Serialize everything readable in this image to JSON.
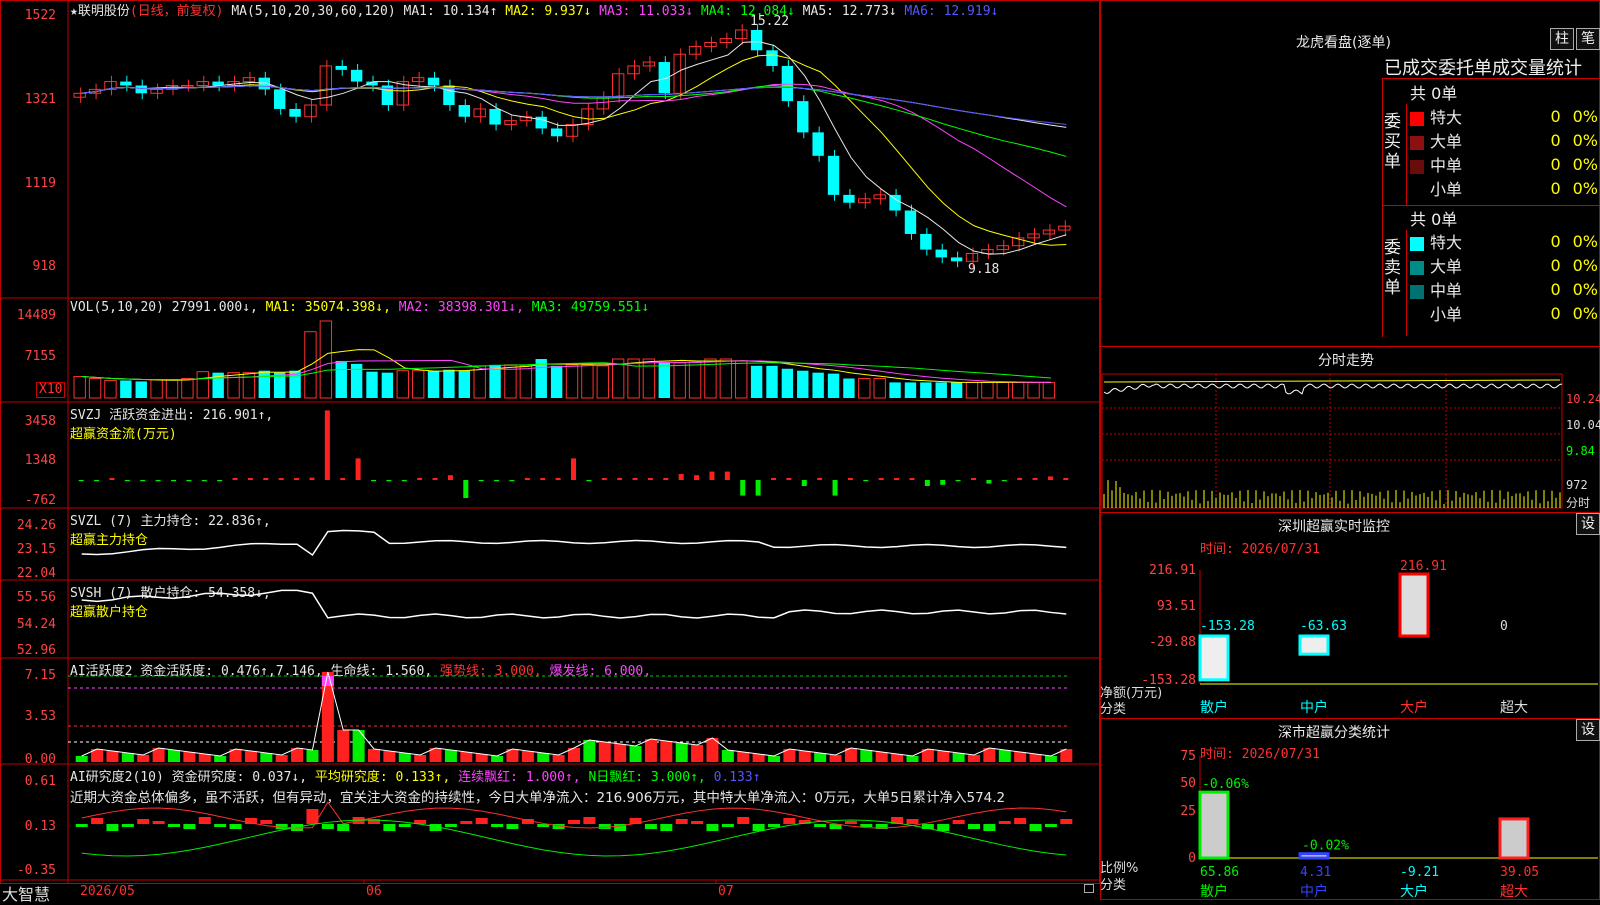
{
  "stock": {
    "name": "★联明股份",
    "mode": "(日线，前复权)"
  },
  "ma_header": {
    "label": "MA(5,10,20,30,60,120)",
    "items": [
      {
        "text": "MA1: 10.134↑",
        "color": "#e6e6e6"
      },
      {
        "text": "MA2: 9.937↓",
        "color": "#ffff00"
      },
      {
        "text": "MA3: 11.033↓",
        "color": "#ff44ff"
      },
      {
        "text": "MA4: 12.084↓",
        "color": "#00ff00"
      },
      {
        "text": "MA5: 12.773↓",
        "color": "#e6e6e6"
      },
      {
        "text": "MA6: 12.919↓",
        "color": "#5555ff"
      }
    ],
    "high_mark": "15.22",
    "low_mark": "9.18"
  },
  "price_axis": [
    "1522",
    "1321",
    "1119",
    "918"
  ],
  "vol_header": {
    "label": "VOL(5,10,20)",
    "value": "27991.000↓,",
    "ma1": "MA1: 35074.398↓,",
    "ma2": "MA2: 38398.301↓,",
    "ma3": "MA3: 49759.551↓"
  },
  "vol_axis": [
    "14489",
    "7155"
  ],
  "vol_unit": "X10",
  "svzj": {
    "label": "SVZJ  活跃资金进出: 216.901↑,",
    "sub": "超赢资金流(万元)",
    "axis": [
      "3458",
      "1348",
      "-762"
    ]
  },
  "svzl": {
    "label": "SVZL (7) 主力持仓: 22.836↑,",
    "sub": "超赢主力持仓",
    "axis": [
      "24.26",
      "23.15",
      "22.04"
    ]
  },
  "svsh": {
    "label": "SVSH (7) 散户持仓: 54.358↓,",
    "sub": "超赢散户持仓",
    "axis": [
      "55.56",
      "54.24",
      "52.96"
    ]
  },
  "ai1": {
    "label": "AI活跃度2 资金活跃度: 0.476↑,7.146,",
    "life": "生命线: 1.560,",
    "strong": "强势线: 3.000,",
    "burst": "爆发线: 6.000,",
    "axis": [
      "7.15",
      "3.53",
      "0.00"
    ]
  },
  "ai2": {
    "label": "AI研究度2(10) 资金研究度: 0.037↓,",
    "avg": "平均研究度: 0.133↑,",
    "cont": "连续飘红: 1.000↑,",
    "nday": "N日飘红: 3.000↑,",
    "last": "0.133↑",
    "axis": [
      "0.61",
      "0.13",
      "-0.35"
    ],
    "comment": "近期大资金总体偏多，虽不活跃，但有异动，宜关注大资金的持续性，今日大单净流入：216.906万元，其中特大单净流入：0万元，大单5日累计净入574.2"
  },
  "x_axis": {
    "start": "2026/05",
    "m6": "06",
    "m7": "07"
  },
  "brand": "大智慧",
  "longhu": {
    "title": "龙虎看盘(逐单)",
    "btn1": "柱",
    "btn2": "笔",
    "subtitle": "已成交委托单成交量统计",
    "buy": {
      "side": "委买单",
      "total": "共 0单",
      "rows": [
        {
          "name": "特大",
          "v": "0",
          "p": "0%",
          "color": "#ff0000"
        },
        {
          "name": "大单",
          "v": "0",
          "p": "0%",
          "color": "#8b1010"
        },
        {
          "name": "中单",
          "v": "0",
          "p": "0%",
          "color": "#6a0c0c"
        },
        {
          "name": "小单",
          "v": "0",
          "p": "0%",
          "color": ""
        }
      ]
    },
    "sell": {
      "side": "委卖单",
      "total": "共 0单",
      "rows": [
        {
          "name": "特大",
          "v": "0",
          "p": "0%",
          "color": "#00ffff"
        },
        {
          "name": "大单",
          "v": "0",
          "p": "0%",
          "color": "#008b8b"
        },
        {
          "name": "中单",
          "v": "0",
          "p": "0%",
          "color": "#007070"
        },
        {
          "name": "小单",
          "v": "0",
          "p": "0%",
          "color": ""
        }
      ]
    }
  },
  "intraday": {
    "title": "分时走势",
    "axis": [
      "10.24",
      "10.04",
      "9.84"
    ],
    "vol": "972",
    "unit": "分时"
  },
  "sz_monitor": {
    "title": "深圳超赢实时监控",
    "btn": "设",
    "time": "时间: 2026/07/31",
    "axis": [
      "216.91",
      "93.51",
      "-29.88",
      "-153.28"
    ],
    "ylabel1": "净额(万元)",
    "ylabel2": "分类",
    "bars": [
      {
        "cat": "散户",
        "value": -153.28,
        "label": "-153.28"
      },
      {
        "cat": "中户",
        "value": -63.63,
        "label": "-63.63"
      },
      {
        "cat": "大户",
        "value": 216.91,
        "label": "216.91"
      },
      {
        "cat": "超大",
        "value": 0,
        "label": "0"
      }
    ]
  },
  "sz_class": {
    "title": "深市超赢分类统计",
    "btn": "设",
    "time": "时间: 2026/07/31",
    "axis": [
      "75",
      "50",
      "25",
      "0"
    ],
    "ylabel1": "比例%",
    "ylabel2": "分类",
    "bars": [
      {
        "cat": "散户",
        "value": 65.86,
        "label": "65.86",
        "top": "-0.06%"
      },
      {
        "cat": "中户",
        "value": 4.31,
        "label": "4.31",
        "top": "-0.02%"
      },
      {
        "cat": "大户",
        "value": -9.21,
        "label": "-9.21",
        "top": ""
      },
      {
        "cat": "超大",
        "value": 39.05,
        "label": "39.05",
        "top": ""
      }
    ]
  },
  "chart_data": [
    {
      "type": "candlestick",
      "title": "联明股份 日线",
      "ohlc_close": [
        13.6,
        13.7,
        13.9,
        13.8,
        13.6,
        13.7,
        13.8,
        13.8,
        13.9,
        13.8,
        13.9,
        14.0,
        13.7,
        13.2,
        13.0,
        13.3,
        14.3,
        14.2,
        13.9,
        13.8,
        13.3,
        13.9,
        14.0,
        13.8,
        13.3,
        13.0,
        13.2,
        12.8,
        12.9,
        13.0,
        12.7,
        12.5,
        12.8,
        13.2,
        13.5,
        14.1,
        14.3,
        14.4,
        13.6,
        14.6,
        14.8,
        14.9,
        15.0,
        15.22,
        14.7,
        14.3,
        13.4,
        12.6,
        12.0,
        11.0,
        10.8,
        10.9,
        11.0,
        10.6,
        10.0,
        9.6,
        9.4,
        9.3,
        9.5,
        9.6,
        9.7,
        9.9,
        10.0,
        10.1,
        10.2
      ],
      "y_range": [
        9.18,
        15.22
      ],
      "high": 15.22,
      "low": 9.18
    },
    {
      "type": "bar",
      "title": "VOL",
      "values": [
        2.2,
        2.0,
        1.8,
        1.8,
        1.7,
        1.9,
        1.9,
        2.0,
        2.7,
        2.6,
        2.6,
        2.6,
        2.8,
        2.6,
        2.8,
        6.8,
        7.9,
        3.8,
        3.5,
        2.7,
        2.6,
        2.8,
        2.8,
        2.8,
        2.9,
        2.8,
        3.3,
        3.4,
        3.4,
        3.3,
        4.0,
        3.3,
        3.4,
        3.4,
        3.3,
        4.0,
        4.0,
        4.0,
        3.7,
        3.6,
        3.7,
        4.0,
        4.0,
        3.8,
        3.3,
        3.3,
        3.0,
        2.8,
        2.6,
        2.5,
        2.0,
        2.0,
        2.0,
        1.6,
        1.6,
        1.6,
        1.6,
        1.6,
        1.6,
        1.6,
        1.6,
        1.6,
        1.6,
        1.6
      ],
      "y_range": [
        0,
        14489
      ]
    },
    {
      "type": "bar",
      "title": "超赢资金流",
      "values": [
        -1,
        -1,
        0,
        -1,
        -1,
        -1,
        -1,
        -1,
        -1,
        -1,
        0,
        0,
        0,
        0,
        0,
        2,
        58,
        0,
        18,
        -1,
        -1,
        -1,
        0,
        0,
        4,
        -15,
        -1,
        -1,
        -1,
        0,
        0,
        0,
        18,
        -1,
        0,
        0,
        0,
        0,
        0,
        5,
        4,
        7,
        7,
        -13,
        -13,
        0,
        0,
        -5,
        0,
        -13,
        0,
        -1,
        0,
        0,
        0,
        -5,
        -4,
        -1,
        0,
        -3,
        -1,
        0,
        0,
        3,
        0
      ]
    }
  ]
}
